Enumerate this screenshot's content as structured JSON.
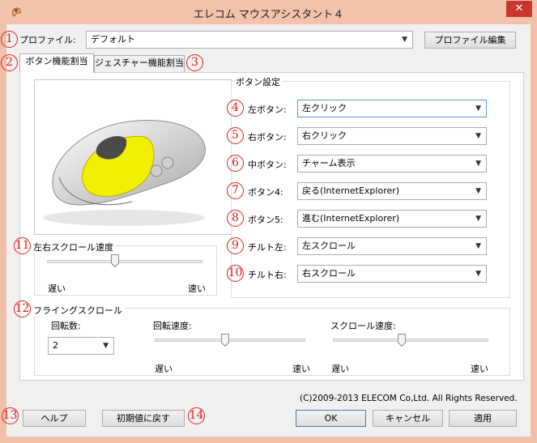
{
  "window": {
    "title": "エレコム マウスアシスタント４",
    "close_label": "✕"
  },
  "profile": {
    "label": "プロファイル:",
    "value": "デフォルト",
    "edit_button": "プロファイル編集"
  },
  "tabs": [
    {
      "label": "ボタン機能割当",
      "active": true
    },
    {
      "label": "ジェスチャー機能割当",
      "active": false
    }
  ],
  "button_settings": {
    "group_title": "ボタン設定",
    "rows": [
      {
        "badge": "4",
        "label": "左ボタン:",
        "value": "左クリック"
      },
      {
        "badge": "5",
        "label": "右ボタン:",
        "value": "右クリック"
      },
      {
        "badge": "6",
        "label": "中ボタン:",
        "value": "チャーム表示"
      },
      {
        "badge": "7",
        "label": "ボタン4:",
        "value": "戻る(InternetExplorer)"
      },
      {
        "badge": "8",
        "label": "ボタン5:",
        "value": "進む(InternetExplorer)"
      },
      {
        "badge": "9",
        "label": "チルト左:",
        "value": "左スクロール"
      },
      {
        "badge": "10",
        "label": "チルト右:",
        "value": "右スクロール"
      }
    ]
  },
  "horizontal_scroll": {
    "title": "左右スクロール速度",
    "slow": "遅い",
    "fast": "速い",
    "level": 0.4
  },
  "flying_scroll": {
    "title": "フライングスクロール",
    "rotations_label": "回転数:",
    "rotations_value": "2",
    "rotation_speed_label": "回転速度:",
    "rotation_speed_level": 0.5,
    "scroll_speed_label": "スクロール速度:",
    "scroll_speed_level": 0.45,
    "slow": "遅い",
    "fast": "速い"
  },
  "badges": {
    "profile": "1",
    "tab1": "2",
    "tab2": "3",
    "hscroll": "11",
    "flying": "12",
    "help": "13",
    "reset": "14"
  },
  "copyright": "(C)2009-2013 ELECOM Co,Ltd. All Rights Reserved.",
  "buttons": {
    "help": "ヘルプ",
    "reset": "初期値に戻す",
    "ok": "OK",
    "cancel": "キャンセル",
    "apply": "適用"
  },
  "colors": {
    "titlebar": "#f2c3aa",
    "close": "#c7372d",
    "badge": "#e02020",
    "mouse_highlight": "#f0f000"
  }
}
